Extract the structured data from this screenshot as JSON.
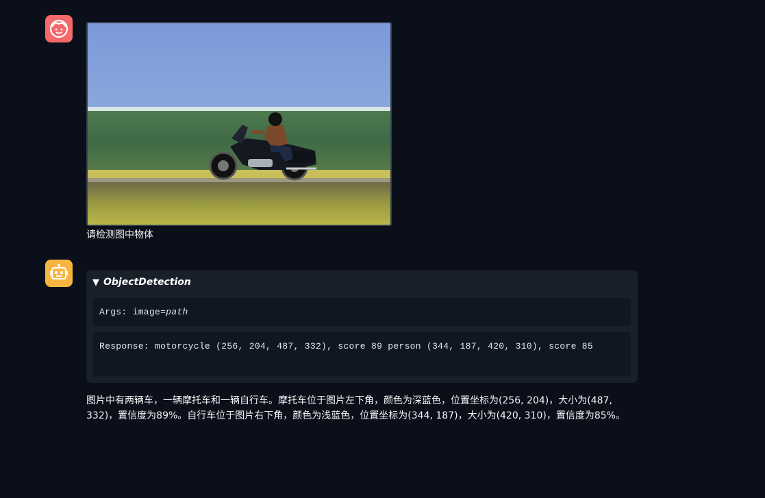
{
  "user_message": {
    "avatar_icon": "user-face-icon",
    "avatar_color": "#f4696b",
    "image_alt": "motorcycle-rider-photo",
    "text": "请检测图中物体"
  },
  "bot_message": {
    "avatar_icon": "robot-icon",
    "avatar_color": "#f7b53f",
    "tool_call": {
      "toggle_icon": "▼",
      "name": "ObjectDetection",
      "args_prefix": "Args: image=",
      "args_value": "path",
      "response": "Response: motorcycle (256, 204, 487, 332), score 89 person (344, 187, 420, 310), score 85"
    },
    "answer": "图片中有两辆车，一辆摩托车和一辆自行车。摩托车位于图片左下角，颜色为深蓝色，位置坐标为(256, 204)，大小为(487, 332)，置信度为89%。自行车位于图片右下角，颜色为浅蓝色，位置坐标为(344, 187)，大小为(420, 310)，置信度为85%。"
  }
}
